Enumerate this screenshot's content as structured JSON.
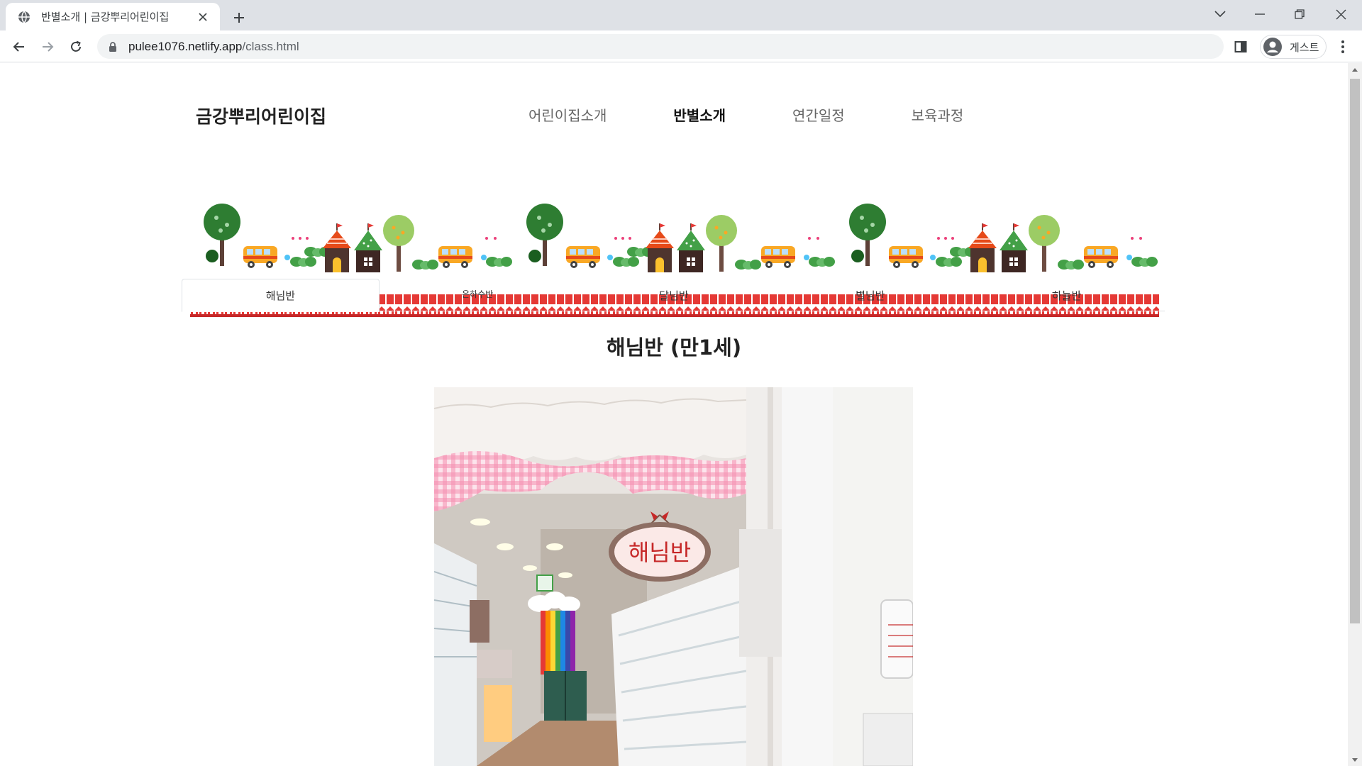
{
  "browser": {
    "tab_title": "반별소개 | 금강뿌리어린이집",
    "url_host": "pulee1076.netlify.app",
    "url_path": "/class.html",
    "profile_label": "게스트"
  },
  "site": {
    "logo": "금강뿌리어린이집",
    "nav": [
      "어린이집소개",
      "반별소개",
      "연간일정",
      "보육과정"
    ],
    "active_nav": "반별소개"
  },
  "class_tabs": [
    "해님반",
    "은하수반",
    "달님반",
    "별님반",
    "하늘반"
  ],
  "active_class_tab": "해님반",
  "class_title": "해님반 (만1세)",
  "photo_sign_text": "해님반",
  "colors": {
    "accent_red": "#e53935",
    "brand_text": "#222222"
  }
}
